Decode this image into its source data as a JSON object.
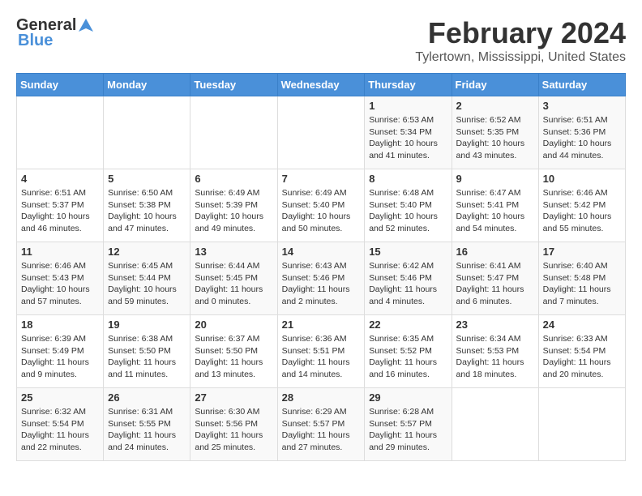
{
  "logo": {
    "general": "General",
    "blue": "Blue"
  },
  "title": {
    "month_year": "February 2024",
    "location": "Tylertown, Mississippi, United States"
  },
  "days_of_week": [
    "Sunday",
    "Monday",
    "Tuesday",
    "Wednesday",
    "Thursday",
    "Friday",
    "Saturday"
  ],
  "weeks": [
    [
      {
        "day": "",
        "info": ""
      },
      {
        "day": "",
        "info": ""
      },
      {
        "day": "",
        "info": ""
      },
      {
        "day": "",
        "info": ""
      },
      {
        "day": "1",
        "info": "Sunrise: 6:53 AM\nSunset: 5:34 PM\nDaylight: 10 hours\nand 41 minutes."
      },
      {
        "day": "2",
        "info": "Sunrise: 6:52 AM\nSunset: 5:35 PM\nDaylight: 10 hours\nand 43 minutes."
      },
      {
        "day": "3",
        "info": "Sunrise: 6:51 AM\nSunset: 5:36 PM\nDaylight: 10 hours\nand 44 minutes."
      }
    ],
    [
      {
        "day": "4",
        "info": "Sunrise: 6:51 AM\nSunset: 5:37 PM\nDaylight: 10 hours\nand 46 minutes."
      },
      {
        "day": "5",
        "info": "Sunrise: 6:50 AM\nSunset: 5:38 PM\nDaylight: 10 hours\nand 47 minutes."
      },
      {
        "day": "6",
        "info": "Sunrise: 6:49 AM\nSunset: 5:39 PM\nDaylight: 10 hours\nand 49 minutes."
      },
      {
        "day": "7",
        "info": "Sunrise: 6:49 AM\nSunset: 5:40 PM\nDaylight: 10 hours\nand 50 minutes."
      },
      {
        "day": "8",
        "info": "Sunrise: 6:48 AM\nSunset: 5:40 PM\nDaylight: 10 hours\nand 52 minutes."
      },
      {
        "day": "9",
        "info": "Sunrise: 6:47 AM\nSunset: 5:41 PM\nDaylight: 10 hours\nand 54 minutes."
      },
      {
        "day": "10",
        "info": "Sunrise: 6:46 AM\nSunset: 5:42 PM\nDaylight: 10 hours\nand 55 minutes."
      }
    ],
    [
      {
        "day": "11",
        "info": "Sunrise: 6:46 AM\nSunset: 5:43 PM\nDaylight: 10 hours\nand 57 minutes."
      },
      {
        "day": "12",
        "info": "Sunrise: 6:45 AM\nSunset: 5:44 PM\nDaylight: 10 hours\nand 59 minutes."
      },
      {
        "day": "13",
        "info": "Sunrise: 6:44 AM\nSunset: 5:45 PM\nDaylight: 11 hours\nand 0 minutes."
      },
      {
        "day": "14",
        "info": "Sunrise: 6:43 AM\nSunset: 5:46 PM\nDaylight: 11 hours\nand 2 minutes."
      },
      {
        "day": "15",
        "info": "Sunrise: 6:42 AM\nSunset: 5:46 PM\nDaylight: 11 hours\nand 4 minutes."
      },
      {
        "day": "16",
        "info": "Sunrise: 6:41 AM\nSunset: 5:47 PM\nDaylight: 11 hours\nand 6 minutes."
      },
      {
        "day": "17",
        "info": "Sunrise: 6:40 AM\nSunset: 5:48 PM\nDaylight: 11 hours\nand 7 minutes."
      }
    ],
    [
      {
        "day": "18",
        "info": "Sunrise: 6:39 AM\nSunset: 5:49 PM\nDaylight: 11 hours\nand 9 minutes."
      },
      {
        "day": "19",
        "info": "Sunrise: 6:38 AM\nSunset: 5:50 PM\nDaylight: 11 hours\nand 11 minutes."
      },
      {
        "day": "20",
        "info": "Sunrise: 6:37 AM\nSunset: 5:50 PM\nDaylight: 11 hours\nand 13 minutes."
      },
      {
        "day": "21",
        "info": "Sunrise: 6:36 AM\nSunset: 5:51 PM\nDaylight: 11 hours\nand 14 minutes."
      },
      {
        "day": "22",
        "info": "Sunrise: 6:35 AM\nSunset: 5:52 PM\nDaylight: 11 hours\nand 16 minutes."
      },
      {
        "day": "23",
        "info": "Sunrise: 6:34 AM\nSunset: 5:53 PM\nDaylight: 11 hours\nand 18 minutes."
      },
      {
        "day": "24",
        "info": "Sunrise: 6:33 AM\nSunset: 5:54 PM\nDaylight: 11 hours\nand 20 minutes."
      }
    ],
    [
      {
        "day": "25",
        "info": "Sunrise: 6:32 AM\nSunset: 5:54 PM\nDaylight: 11 hours\nand 22 minutes."
      },
      {
        "day": "26",
        "info": "Sunrise: 6:31 AM\nSunset: 5:55 PM\nDaylight: 11 hours\nand 24 minutes."
      },
      {
        "day": "27",
        "info": "Sunrise: 6:30 AM\nSunset: 5:56 PM\nDaylight: 11 hours\nand 25 minutes."
      },
      {
        "day": "28",
        "info": "Sunrise: 6:29 AM\nSunset: 5:57 PM\nDaylight: 11 hours\nand 27 minutes."
      },
      {
        "day": "29",
        "info": "Sunrise: 6:28 AM\nSunset: 5:57 PM\nDaylight: 11 hours\nand 29 minutes."
      },
      {
        "day": "",
        "info": ""
      },
      {
        "day": "",
        "info": ""
      }
    ]
  ]
}
